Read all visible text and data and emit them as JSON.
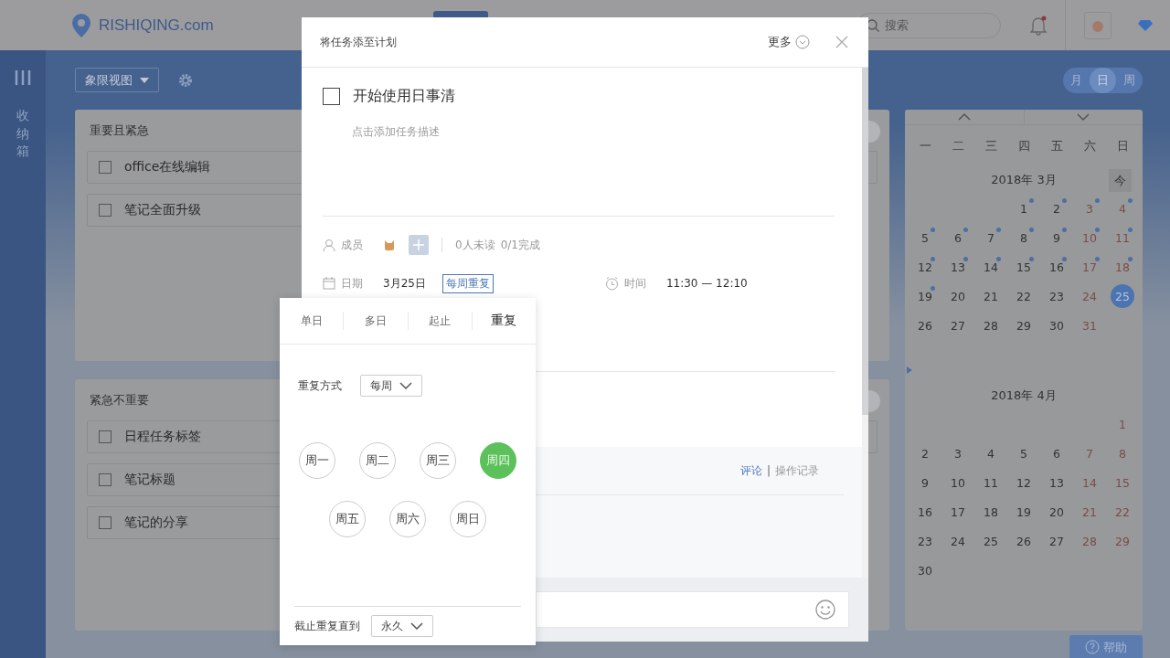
{
  "header": {
    "logo_text": "RISHIQING.com",
    "search_placeholder": "搜索"
  },
  "sidebar": {
    "label": "收纳箱"
  },
  "toolbar": {
    "view_select": "象限视图"
  },
  "view_switch": [
    {
      "label": "月",
      "selected": false
    },
    {
      "label": "日",
      "selected": true
    },
    {
      "label": "周",
      "selected": false
    }
  ],
  "quadrants": [
    {
      "title": "重要且紧急",
      "tasks": [
        {
          "label": "office在线编辑",
          "checked": false
        },
        {
          "label": "笔记全面升级",
          "checked": false
        }
      ]
    },
    {
      "title": "紧急不重要",
      "tasks": [
        {
          "label": "日程任务标签",
          "checked": false
        },
        {
          "label": "笔记标题",
          "checked": false
        },
        {
          "label": "笔记的分享",
          "checked": false
        }
      ]
    }
  ],
  "calendar": {
    "weekdays": [
      "一",
      "二",
      "三",
      "四",
      "五",
      "六",
      "日"
    ],
    "today_button": "今",
    "months": [
      {
        "title": "2018年 3月",
        "weeks": [
          [
            {
              "label": "1",
              "weekend": false,
              "event": true,
              "selected": false
            },
            {
              "label": "2",
              "weekend": false,
              "event": true,
              "selected": false
            },
            {
              "label": "3",
              "weekend": true,
              "event": true,
              "selected": false
            },
            {
              "label": "4",
              "weekend": true,
              "event": true,
              "selected": false
            }
          ],
          [
            {
              "label": "5",
              "weekend": false,
              "event": true,
              "selected": false
            },
            {
              "label": "6",
              "weekend": false,
              "event": true,
              "selected": false
            },
            {
              "label": "7",
              "weekend": false,
              "event": true,
              "selected": false
            },
            {
              "label": "8",
              "weekend": false,
              "event": true,
              "selected": false
            },
            {
              "label": "9",
              "weekend": false,
              "event": true,
              "selected": false
            },
            {
              "label": "10",
              "weekend": true,
              "event": true,
              "selected": false
            },
            {
              "label": "11",
              "weekend": true,
              "event": true,
              "selected": false
            }
          ],
          [
            {
              "label": "12",
              "weekend": false,
              "event": true,
              "selected": false
            },
            {
              "label": "13",
              "weekend": false,
              "event": true,
              "selected": false
            },
            {
              "label": "14",
              "weekend": false,
              "event": true,
              "selected": false
            },
            {
              "label": "15",
              "weekend": false,
              "event": true,
              "selected": false
            },
            {
              "label": "16",
              "weekend": false,
              "event": true,
              "selected": false
            },
            {
              "label": "17",
              "weekend": true,
              "event": true,
              "selected": false
            },
            {
              "label": "18",
              "weekend": true,
              "event": true,
              "selected": false
            }
          ],
          [
            {
              "label": "19",
              "weekend": false,
              "event": true,
              "selected": false
            },
            {
              "label": "20",
              "weekend": false,
              "event": false,
              "selected": false
            },
            {
              "label": "21",
              "weekend": false,
              "event": false,
              "selected": false
            },
            {
              "label": "22",
              "weekend": false,
              "event": false,
              "selected": false
            },
            {
              "label": "23",
              "weekend": false,
              "event": false,
              "selected": false
            },
            {
              "label": "24",
              "weekend": true,
              "event": false,
              "selected": false
            },
            {
              "label": "25",
              "weekend": true,
              "event": false,
              "selected": true
            }
          ],
          [
            {
              "label": "26",
              "weekend": false,
              "event": false,
              "selected": false
            },
            {
              "label": "27",
              "weekend": false,
              "event": false,
              "selected": false
            },
            {
              "label": "28",
              "weekend": false,
              "event": false,
              "selected": false
            },
            {
              "label": "29",
              "weekend": false,
              "event": false,
              "selected": false
            },
            {
              "label": "30",
              "weekend": false,
              "event": false,
              "selected": false
            },
            {
              "label": "31",
              "weekend": true,
              "event": false,
              "selected": false
            }
          ]
        ]
      },
      {
        "title": "2018年 4月",
        "weeks": [
          [
            {
              "label": "1",
              "weekend": true,
              "event": false,
              "selected": false
            }
          ],
          [
            {
              "label": "2",
              "weekend": false,
              "event": false,
              "selected": false
            },
            {
              "label": "3",
              "weekend": false,
              "event": false,
              "selected": false
            },
            {
              "label": "4",
              "weekend": false,
              "event": false,
              "selected": false
            },
            {
              "label": "5",
              "weekend": false,
              "event": false,
              "selected": false
            },
            {
              "label": "6",
              "weekend": false,
              "event": false,
              "selected": false
            },
            {
              "label": "7",
              "weekend": true,
              "event": false,
              "selected": false
            },
            {
              "label": "8",
              "weekend": true,
              "event": false,
              "selected": false
            }
          ],
          [
            {
              "label": "9",
              "weekend": false,
              "event": false,
              "selected": false
            },
            {
              "label": "10",
              "weekend": false,
              "event": false,
              "selected": false
            },
            {
              "label": "11",
              "weekend": false,
              "event": false,
              "selected": false
            },
            {
              "label": "12",
              "weekend": false,
              "event": false,
              "selected": false
            },
            {
              "label": "13",
              "weekend": false,
              "event": false,
              "selected": false
            },
            {
              "label": "14",
              "weekend": true,
              "event": false,
              "selected": false
            },
            {
              "label": "15",
              "weekend": true,
              "event": false,
              "selected": false
            }
          ],
          [
            {
              "label": "16",
              "weekend": false,
              "event": false,
              "selected": false
            },
            {
              "label": "17",
              "weekend": false,
              "event": false,
              "selected": false
            },
            {
              "label": "18",
              "weekend": false,
              "event": false,
              "selected": false
            },
            {
              "label": "19",
              "weekend": false,
              "event": false,
              "selected": false
            },
            {
              "label": "20",
              "weekend": false,
              "event": false,
              "selected": false
            },
            {
              "label": "21",
              "weekend": true,
              "event": false,
              "selected": false
            },
            {
              "label": "22",
              "weekend": true,
              "event": false,
              "selected": false
            }
          ],
          [
            {
              "label": "23",
              "weekend": false,
              "event": false,
              "selected": false
            },
            {
              "label": "24",
              "weekend": false,
              "event": false,
              "selected": false
            },
            {
              "label": "25",
              "weekend": false,
              "event": false,
              "selected": false
            },
            {
              "label": "26",
              "weekend": false,
              "event": false,
              "selected": false
            },
            {
              "label": "27",
              "weekend": false,
              "event": false,
              "selected": false
            },
            {
              "label": "28",
              "weekend": true,
              "event": false,
              "selected": false
            },
            {
              "label": "29",
              "weekend": true,
              "event": false,
              "selected": false
            }
          ],
          [
            {
              "label": "30",
              "weekend": false,
              "event": false,
              "selected": false
            }
          ]
        ]
      }
    ]
  },
  "help_button": "帮助",
  "modal": {
    "title": "将任务添至计划",
    "more": "更多",
    "task_title": "开始使用日事清",
    "task_checked": false,
    "description_placeholder": "点击添加任务描述",
    "members_label": "成员",
    "read_status": "0人未读",
    "done_status": "0/1完成",
    "date_label": "日期",
    "date_value": "3月25日",
    "repeat_tag": "每周重复",
    "time_label": "时间",
    "time_value": "11:30 — 12:10",
    "comment_separator": "|",
    "comment_tabs": [
      {
        "label": "评论",
        "selected": true
      },
      {
        "label": "操作记录",
        "selected": false
      }
    ]
  },
  "repeat_popup": {
    "tabs": [
      {
        "label": "单日",
        "selected": false
      },
      {
        "label": "多日",
        "selected": false
      },
      {
        "label": "起止",
        "selected": false
      },
      {
        "label": "重复",
        "selected": true
      }
    ],
    "mode_label": "重复方式",
    "mode_value": "每周",
    "weekdays": [
      {
        "label": "周一",
        "selected": false
      },
      {
        "label": "周二",
        "selected": false
      },
      {
        "label": "周三",
        "selected": false
      },
      {
        "label": "周四",
        "selected": true
      },
      {
        "label": "周五",
        "selected": false
      },
      {
        "label": "周六",
        "selected": false
      },
      {
        "label": "周日",
        "selected": false
      }
    ],
    "until_label": "截止重复直到",
    "until_value": "永久"
  }
}
